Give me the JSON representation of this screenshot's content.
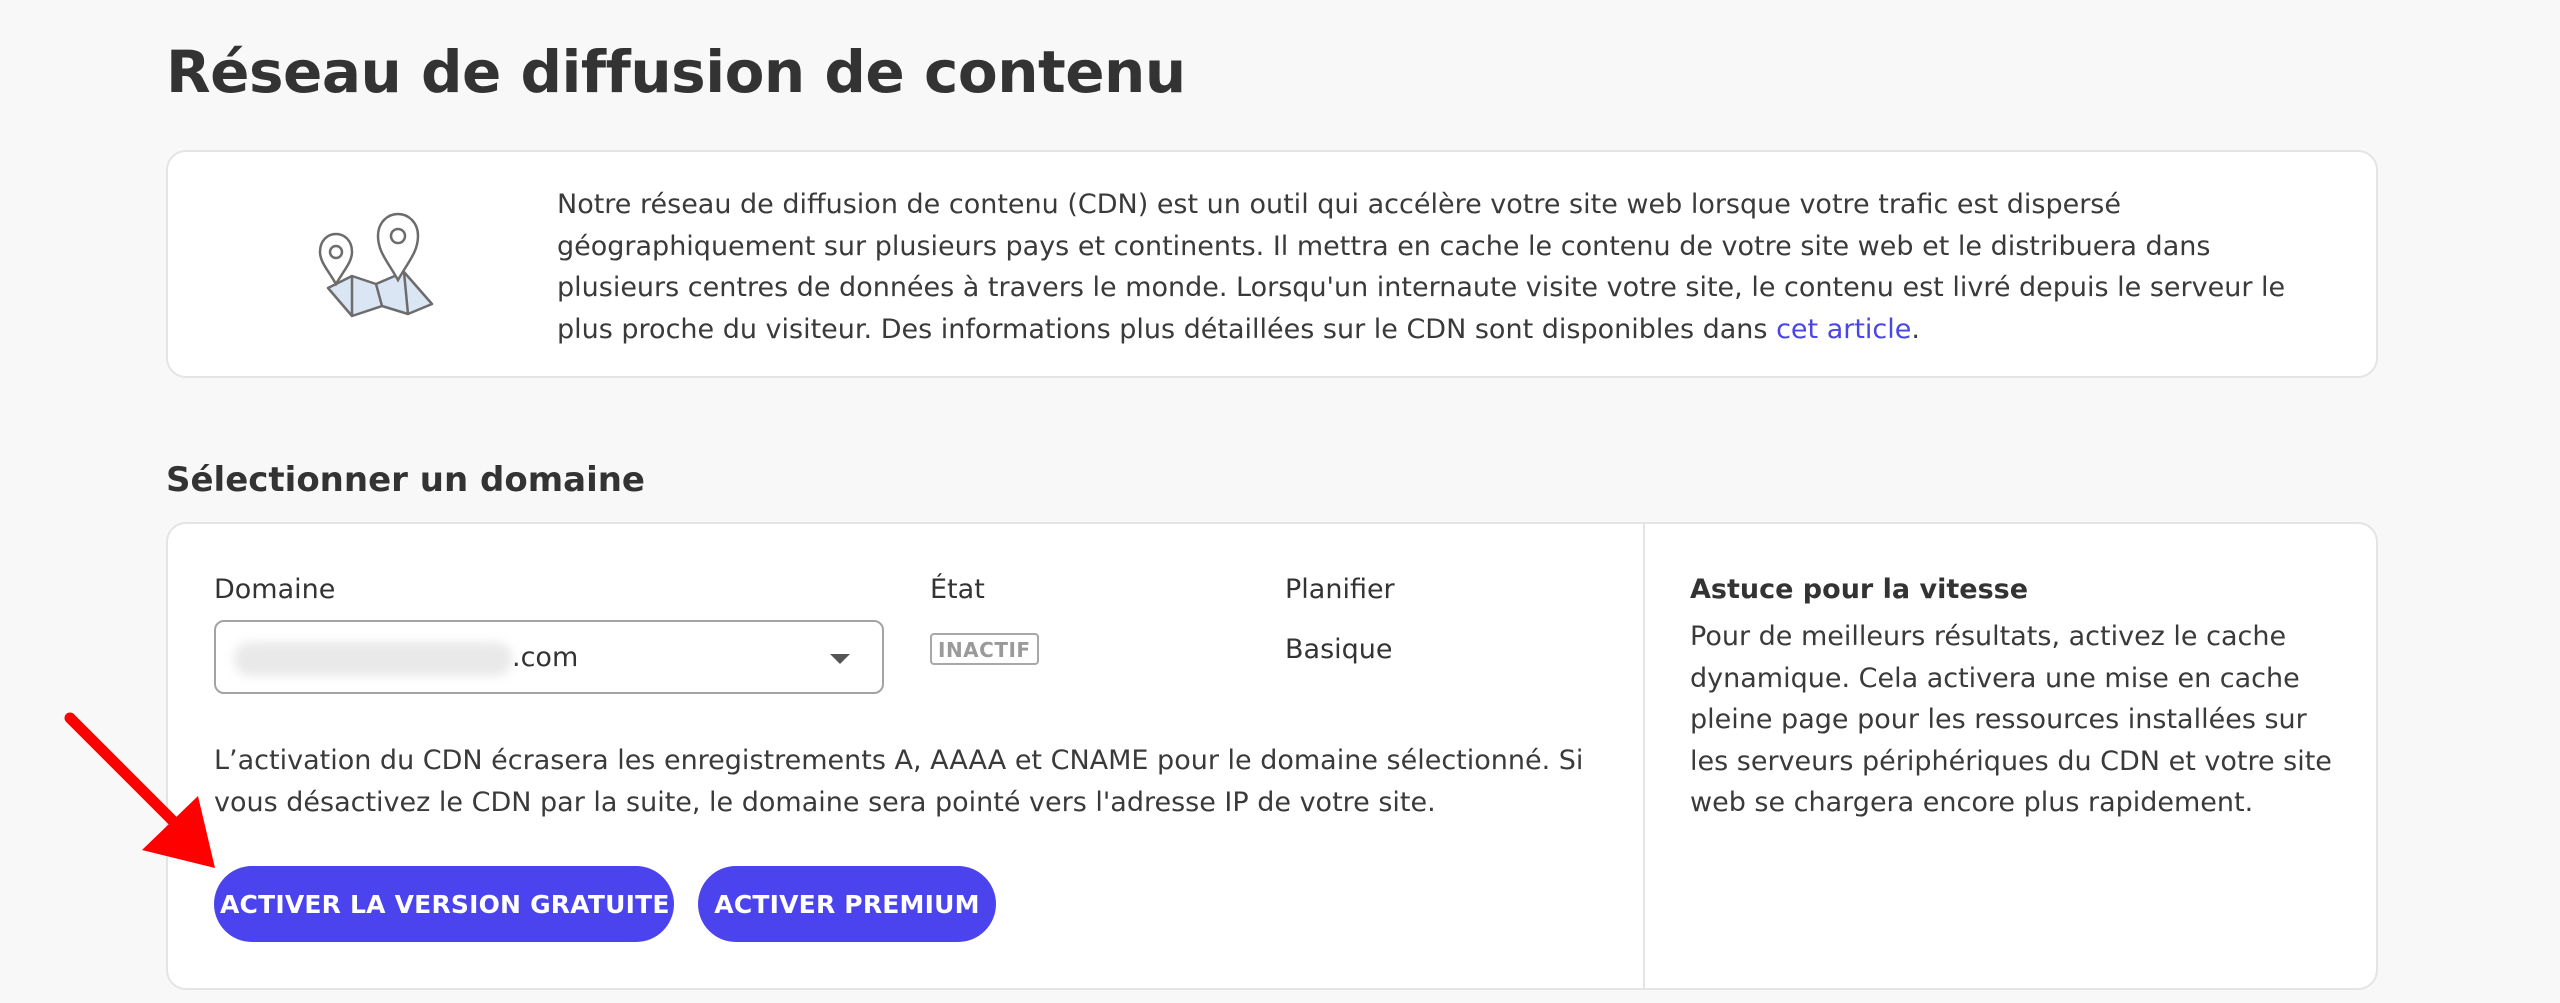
{
  "page": {
    "title": "Réseau de diffusion de contenu"
  },
  "info": {
    "text": "Notre réseau de diffusion de contenu (CDN) est un outil qui accélère votre site web lorsque votre trafic est dispersé géographiquement sur plusieurs pays et continents. Il mettra en cache le contenu de votre site web et le distribuera dans plusieurs centres de données à travers le monde. Lorsqu'un internaute visite votre site, le contenu est livré depuis le serveur le plus proche du visiteur. Des informations plus détaillées sur le CDN sont disponibles dans ",
    "link_label": "cet article",
    "text_end": ".",
    "icon": "map-pins-icon"
  },
  "section": {
    "title": "Sélectionner un domaine"
  },
  "domain": {
    "label": "Domaine",
    "value_suffix": ".com",
    "icon": "chevron-down-icon"
  },
  "status": {
    "label": "État",
    "badge": "INACTIF"
  },
  "plan": {
    "label": "Planifier",
    "value": "Basique"
  },
  "warning": "L’activation du CDN écrasera les enregistrements A, AAAA et CNAME pour le domaine sélectionné. Si vous désactivez le CDN par la suite, le domaine sera pointé vers l'adresse IP de votre site.",
  "buttons": {
    "free": "ACTIVER LA VERSION GRATUITE",
    "premium": "ACTIVER PREMIUM"
  },
  "tip": {
    "title": "Astuce pour la vitesse",
    "text": "Pour de meilleurs résultats, activez le cache dynamique. Cela activera une mise en cache pleine page pour les ressources installées sur les serveurs périphériques du CDN et votre site web se chargera encore plus rapidement."
  },
  "colors": {
    "accent": "#4b44ee",
    "link": "#4a45e6",
    "annotation_arrow": "#ff0000"
  }
}
